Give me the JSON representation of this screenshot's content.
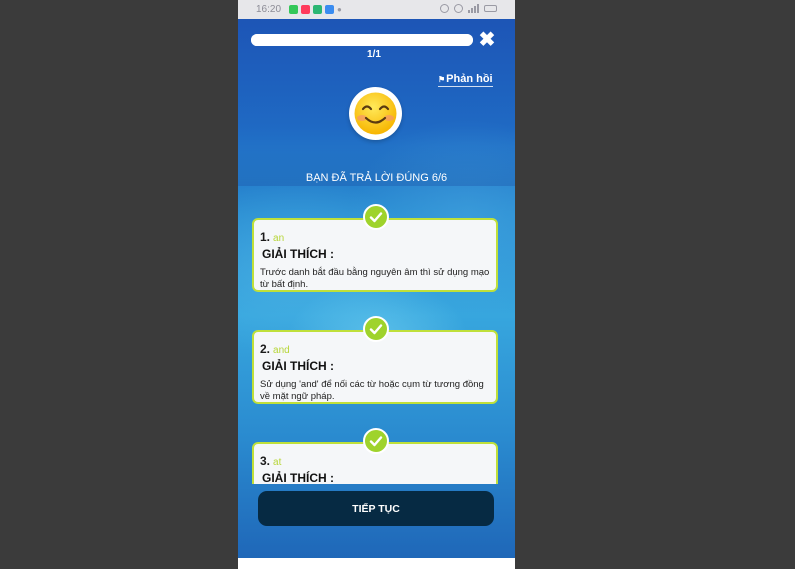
{
  "status_bar": {
    "time": "16:20",
    "app_icon_colors": [
      "#34c759",
      "#ff3b5c",
      "#2bb673",
      "#3a8cf0"
    ]
  },
  "quiz": {
    "progress": 1.0,
    "counter": "1/1",
    "feedback_label": "Phản hồi",
    "result_text": "BẠN ĐÃ TRẢ LỜI ĐÚNG 6/6",
    "items": [
      {
        "number": "1.",
        "answer": "an",
        "heading": "GIẢI THÍCH :",
        "explanation": "Trước danh bắt đầu bằng nguyên âm thì sử dụng mạo từ bất định."
      },
      {
        "number": "2.",
        "answer": "and",
        "heading": "GIẢI THÍCH :",
        "explanation": "Sử dụng 'and' để nối các từ hoặc cụm từ tương đồng về mặt ngữ pháp."
      },
      {
        "number": "3.",
        "answer": "at",
        "heading": "GIẢI THÍCH :",
        "explanation": ""
      }
    ],
    "continue_label": "TIẾP TỤC"
  },
  "colors": {
    "accent_green": "#9fd32c",
    "card_border": "#bfe03a",
    "button_bg": "#062a43"
  },
  "icons": [
    "close-icon",
    "flag-icon",
    "smiley-emoji-icon",
    "check-icon",
    "wifi-icon",
    "signal-icon",
    "battery-icon"
  ]
}
